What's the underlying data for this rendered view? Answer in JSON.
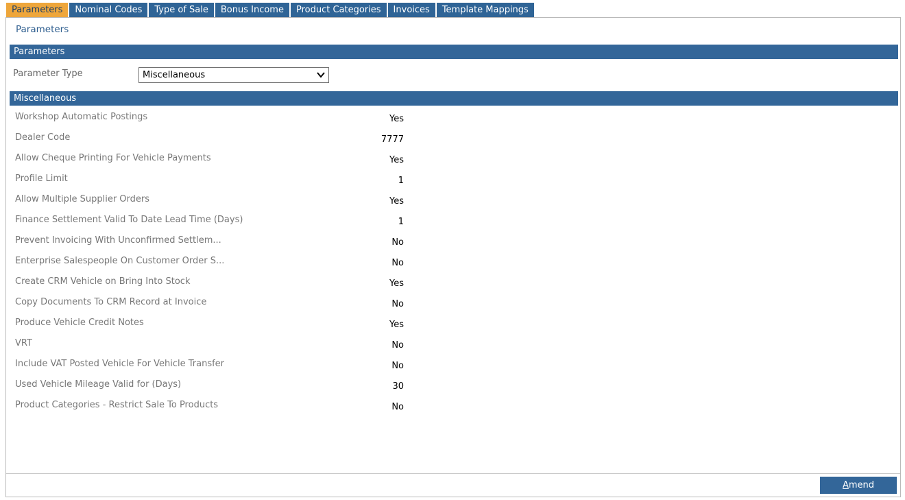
{
  "tabs": [
    {
      "label": "Parameters",
      "active": true
    },
    {
      "label": "Nominal Codes",
      "active": false
    },
    {
      "label": "Type of Sale",
      "active": false
    },
    {
      "label": "Bonus Income",
      "active": false
    },
    {
      "label": "Product Categories",
      "active": false
    },
    {
      "label": "Invoices",
      "active": false
    },
    {
      "label": "Template Mappings",
      "active": false
    }
  ],
  "page": {
    "title": "Parameters"
  },
  "parameters_section": {
    "header": "Parameters",
    "parameter_type_label": "Parameter Type",
    "parameter_type_value": "Miscellaneous"
  },
  "misc_section": {
    "header": "Miscellaneous",
    "rows": [
      {
        "label": "Workshop Automatic Postings",
        "value": "Yes"
      },
      {
        "label": "Dealer Code",
        "value": "7777"
      },
      {
        "label": "Allow Cheque Printing For Vehicle Payments",
        "value": "Yes"
      },
      {
        "label": "Profile Limit",
        "value": "1"
      },
      {
        "label": "Allow Multiple Supplier Orders",
        "value": "Yes"
      },
      {
        "label": "Finance Settlement Valid To Date Lead Time (Days)",
        "value": "1"
      },
      {
        "label": "Prevent Invoicing With Unconfirmed Settlem...",
        "value": "No"
      },
      {
        "label": "Enterprise Salespeople On Customer Order S...",
        "value": "No"
      },
      {
        "label": "Create CRM Vehicle on Bring Into Stock",
        "value": "Yes"
      },
      {
        "label": "Copy Documents To CRM Record at Invoice",
        "value": "No"
      },
      {
        "label": "Produce Vehicle Credit Notes",
        "value": "Yes"
      },
      {
        "label": "VRT",
        "value": "No"
      },
      {
        "label": "Include VAT Posted Vehicle For Vehicle Transfer",
        "value": "No"
      },
      {
        "label": "Used Vehicle Mileage Valid for (Days)",
        "value": "30"
      },
      {
        "label": "Product Categories - Restrict Sale To Products",
        "value": "No"
      }
    ]
  },
  "footer": {
    "amend_hotkey": "A",
    "amend_rest": "mend"
  },
  "colors": {
    "tab": "#2f6496",
    "tab_active": "#eea63b",
    "section_bar": "#336699",
    "button": "#336699"
  },
  "icons": {
    "select_arrow": "chevron-down-icon"
  }
}
